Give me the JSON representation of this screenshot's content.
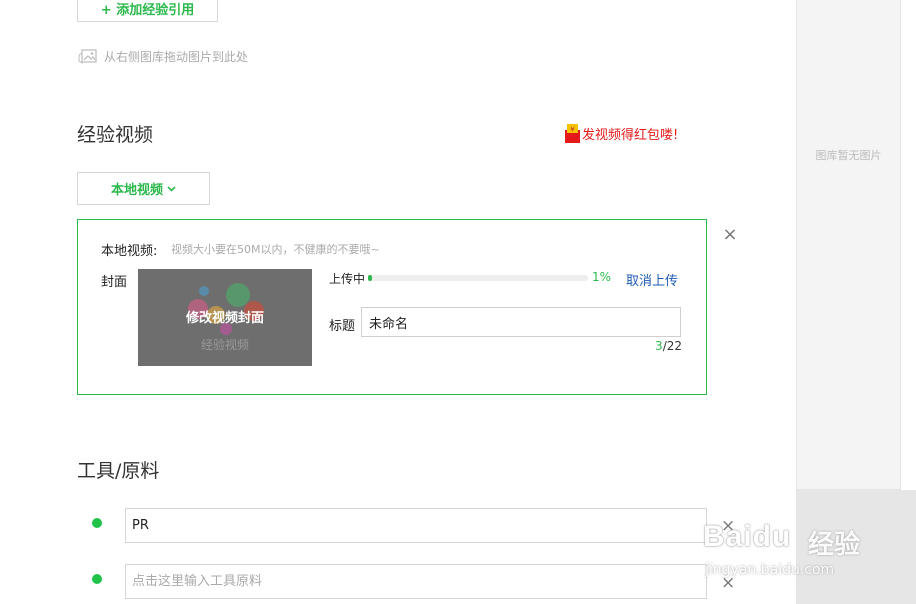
{
  "add_reference": {
    "label": "+ 添加经验引用"
  },
  "drag_hint": {
    "text": "从右侧图库拖动图片到此处"
  },
  "video_section": {
    "title": "经验视频",
    "promo_text": "发视频得红包喽!",
    "promo_icon_glyph": "¥",
    "local_button_label": "本地视频",
    "panel": {
      "local_label": "本地视频:",
      "local_note": "视频大小要在50M以内，不健康的不要哦~",
      "cover_label": "封面",
      "cover_button_text": "修改视频封面",
      "cover_watermark": "经验视频",
      "uploading_label": "上传中",
      "progress_percent": 1,
      "progress_text": "1%",
      "cancel_label": "取消上传",
      "title_label": "标题",
      "title_value": "未命名",
      "char_count_current": "3",
      "char_count_max": "/22",
      "close_glyph": "×"
    }
  },
  "tools_section": {
    "title": "工具/原料",
    "items": [
      {
        "value": "PR",
        "placeholder": ""
      },
      {
        "value": "",
        "placeholder": "点击这里输入工具原料"
      }
    ],
    "remove_glyph": "×"
  },
  "gallery": {
    "empty_text": "图库暂无图片"
  },
  "watermark": {
    "brand": "Baidu",
    "brand_cn": "经验",
    "url": "jingyan.baidu.com"
  },
  "colors": {
    "accent": "#2db84d",
    "link": "#1f5bb5",
    "promo": "#e41a1a"
  }
}
